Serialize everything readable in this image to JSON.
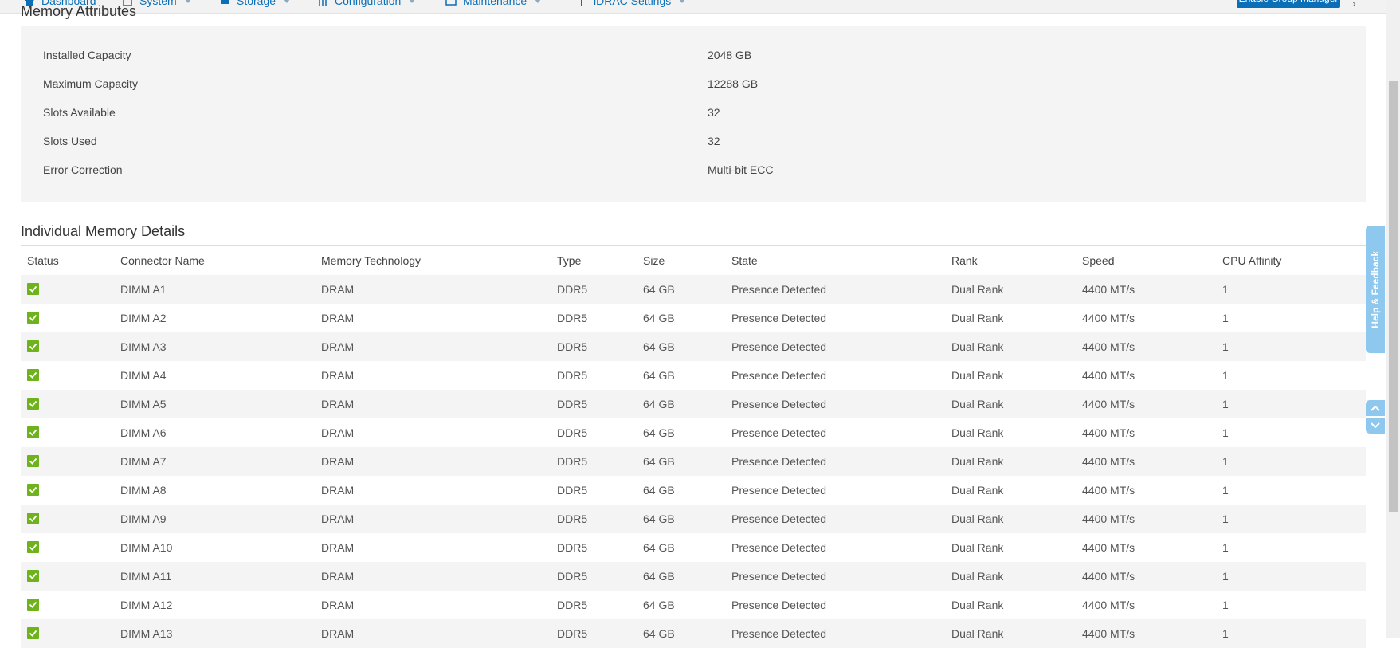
{
  "nav": {
    "items": [
      {
        "label": "Dashboard",
        "icon": "home-icon"
      },
      {
        "label": "System",
        "icon": "system-icon"
      },
      {
        "label": "Storage",
        "icon": "storage-icon"
      },
      {
        "label": "Configuration",
        "icon": "configuration-icon"
      },
      {
        "label": "Maintenance",
        "icon": "maintenance-icon"
      },
      {
        "label": "iDRAC Settings",
        "icon": "idrac-settings-icon"
      }
    ],
    "button_label": "Enable Group Manager"
  },
  "memory_attributes": {
    "title": "Memory Attributes",
    "rows": [
      {
        "label": "Installed Capacity",
        "value": "2048 GB"
      },
      {
        "label": "Maximum Capacity",
        "value": "12288 GB"
      },
      {
        "label": "Slots Available",
        "value": "32"
      },
      {
        "label": "Slots Used",
        "value": "32"
      },
      {
        "label": "Error Correction",
        "value": "Multi-bit ECC"
      }
    ]
  },
  "individual_memory": {
    "title": "Individual Memory Details",
    "columns": [
      "Status",
      "Connector Name",
      "Memory Technology",
      "Type",
      "Size",
      "State",
      "Rank",
      "Speed",
      "CPU Affinity"
    ],
    "rows": [
      {
        "connector": "DIMM A1",
        "tech": "DRAM",
        "type": "DDR5",
        "size": "64 GB",
        "state": "Presence Detected",
        "rank": "Dual Rank",
        "speed": "4400 MT/s",
        "cpu": "1"
      },
      {
        "connector": "DIMM A2",
        "tech": "DRAM",
        "type": "DDR5",
        "size": "64 GB",
        "state": "Presence Detected",
        "rank": "Dual Rank",
        "speed": "4400 MT/s",
        "cpu": "1"
      },
      {
        "connector": "DIMM A3",
        "tech": "DRAM",
        "type": "DDR5",
        "size": "64 GB",
        "state": "Presence Detected",
        "rank": "Dual Rank",
        "speed": "4400 MT/s",
        "cpu": "1"
      },
      {
        "connector": "DIMM A4",
        "tech": "DRAM",
        "type": "DDR5",
        "size": "64 GB",
        "state": "Presence Detected",
        "rank": "Dual Rank",
        "speed": "4400 MT/s",
        "cpu": "1"
      },
      {
        "connector": "DIMM A5",
        "tech": "DRAM",
        "type": "DDR5",
        "size": "64 GB",
        "state": "Presence Detected",
        "rank": "Dual Rank",
        "speed": "4400 MT/s",
        "cpu": "1"
      },
      {
        "connector": "DIMM A6",
        "tech": "DRAM",
        "type": "DDR5",
        "size": "64 GB",
        "state": "Presence Detected",
        "rank": "Dual Rank",
        "speed": "4400 MT/s",
        "cpu": "1"
      },
      {
        "connector": "DIMM A7",
        "tech": "DRAM",
        "type": "DDR5",
        "size": "64 GB",
        "state": "Presence Detected",
        "rank": "Dual Rank",
        "speed": "4400 MT/s",
        "cpu": "1"
      },
      {
        "connector": "DIMM A8",
        "tech": "DRAM",
        "type": "DDR5",
        "size": "64 GB",
        "state": "Presence Detected",
        "rank": "Dual Rank",
        "speed": "4400 MT/s",
        "cpu": "1"
      },
      {
        "connector": "DIMM A9",
        "tech": "DRAM",
        "type": "DDR5",
        "size": "64 GB",
        "state": "Presence Detected",
        "rank": "Dual Rank",
        "speed": "4400 MT/s",
        "cpu": "1"
      },
      {
        "connector": "DIMM A10",
        "tech": "DRAM",
        "type": "DDR5",
        "size": "64 GB",
        "state": "Presence Detected",
        "rank": "Dual Rank",
        "speed": "4400 MT/s",
        "cpu": "1"
      },
      {
        "connector": "DIMM A11",
        "tech": "DRAM",
        "type": "DDR5",
        "size": "64 GB",
        "state": "Presence Detected",
        "rank": "Dual Rank",
        "speed": "4400 MT/s",
        "cpu": "1"
      },
      {
        "connector": "DIMM A12",
        "tech": "DRAM",
        "type": "DDR5",
        "size": "64 GB",
        "state": "Presence Detected",
        "rank": "Dual Rank",
        "speed": "4400 MT/s",
        "cpu": "1"
      },
      {
        "connector": "DIMM A13",
        "tech": "DRAM",
        "type": "DDR5",
        "size": "64 GB",
        "state": "Presence Detected",
        "rank": "Dual Rank",
        "speed": "4400 MT/s",
        "cpu": "1"
      }
    ]
  },
  "help": {
    "label": "Help & Feedback"
  },
  "colors": {
    "status_ok": "#6fb31c",
    "link": "#0b6fb8",
    "help_tab": "#8ec8ef"
  }
}
